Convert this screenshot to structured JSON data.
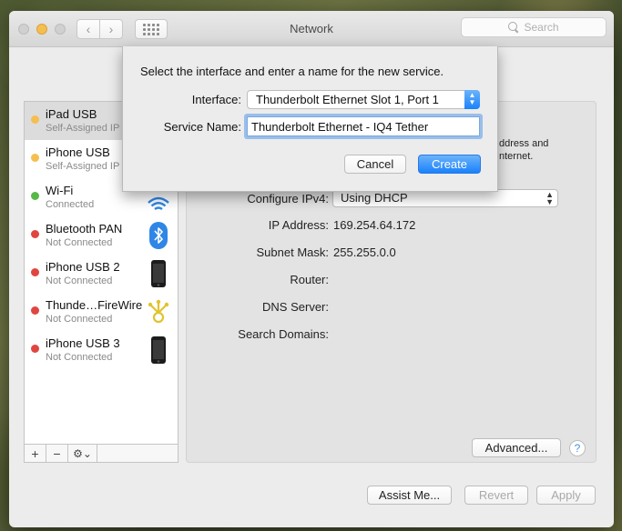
{
  "window": {
    "title": "Network"
  },
  "search": {
    "placeholder": "Search"
  },
  "toolbar": {
    "back": "‹",
    "forward": "›"
  },
  "services": [
    {
      "name": "iPad USB",
      "status": "Self-Assigned IP",
      "dot": "#f5bf4f",
      "icon": "ipad-icon",
      "selected": true
    },
    {
      "name": "iPhone USB",
      "status": "Self-Assigned IP",
      "dot": "#f5bf4f",
      "icon": "iphone-icon"
    },
    {
      "name": "Wi-Fi",
      "status": "Connected",
      "dot": "#56b847",
      "icon": "wifi-icon"
    },
    {
      "name": "Bluetooth PAN",
      "status": "Not Connected",
      "dot": "#e0463f",
      "icon": "bluetooth-icon"
    },
    {
      "name": "iPhone USB 2",
      "status": "Not Connected",
      "dot": "#e0463f",
      "icon": "iphone-icon"
    },
    {
      "name": "Thunde…FireWire",
      "status": "Not Connected",
      "dot": "#e0463f",
      "icon": "firewire-icon"
    },
    {
      "name": "iPhone USB 3",
      "status": "Not Connected",
      "dot": "#e0463f",
      "icon": "iphone-icon"
    }
  ],
  "sidebar_tools": {
    "add": "+",
    "remove": "−",
    "gear": "⚙⌄"
  },
  "detail": {
    "partial_line1": "ddress and",
    "partial_line2": "nternet.",
    "configure_label": "Configure IPv4:",
    "configure_value": "Using DHCP",
    "ip_label": "IP Address:",
    "ip_value": "169.254.64.172",
    "subnet_label": "Subnet Mask:",
    "subnet_value": "255.255.0.0",
    "router_label": "Router:",
    "dns_label": "DNS Server:",
    "search_domains_label": "Search Domains:",
    "advanced_button": "Advanced...",
    "help_button": "?"
  },
  "footer": {
    "assist_button": "Assist Me...",
    "revert_button": "Revert",
    "apply_button": "Apply"
  },
  "sheet": {
    "message": "Select the interface and enter a name for the new service.",
    "interface_label": "Interface:",
    "interface_value": "Thunderbolt Ethernet Slot 1, Port 1",
    "service_name_label": "Service Name:",
    "service_name_value": "Thunderbolt Ethernet - IQ4 Tether",
    "cancel_button": "Cancel",
    "create_button": "Create"
  }
}
